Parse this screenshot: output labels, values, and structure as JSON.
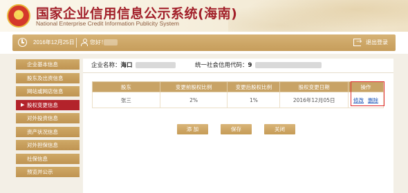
{
  "header": {
    "title_cn": "国家企业信用信息公示系统(海南)",
    "title_en": "National Enterprise Credit Information Publicity System",
    "emblem_glyph": "★"
  },
  "statusbar": {
    "date": "2016年12月25日",
    "greeting": "您好！",
    "logout": "退出登录"
  },
  "sidebar": {
    "items": [
      {
        "label": "企业基本信息",
        "active": false
      },
      {
        "label": "股东及出资信息",
        "active": false
      },
      {
        "label": "网站或网店信息",
        "active": false
      },
      {
        "label": "股权变更信息",
        "active": true
      },
      {
        "label": "对外投资信息",
        "active": false
      },
      {
        "label": "资产状况信息",
        "active": false
      },
      {
        "label": "对外担保信息",
        "active": false
      },
      {
        "label": "社保信息",
        "active": false
      },
      {
        "label": "预览并公示",
        "active": false
      }
    ],
    "active_marker": "▶"
  },
  "main": {
    "company_label": "企业名称：",
    "company_value": "海口",
    "credit_label": "统一社会信用代码：",
    "credit_value": "9"
  },
  "table": {
    "headers": [
      "股东",
      "变更前股权比例",
      "变更后股权比例",
      "股权变更日期",
      "操作"
    ],
    "rows": [
      {
        "shareholder": "张三",
        "before": "2%",
        "after": "1%",
        "date": "2016年12月05日",
        "edit": "修改",
        "delete": "删除"
      }
    ]
  },
  "buttons": {
    "add": "添 加",
    "save": "保存",
    "close": "关闭"
  },
  "colors": {
    "accent_gold": "#c69d5b",
    "active_red": "#b3232b",
    "title_red": "#a2202a",
    "link_blue": "#1f57b8",
    "highlight_box": "#e02b2b"
  }
}
